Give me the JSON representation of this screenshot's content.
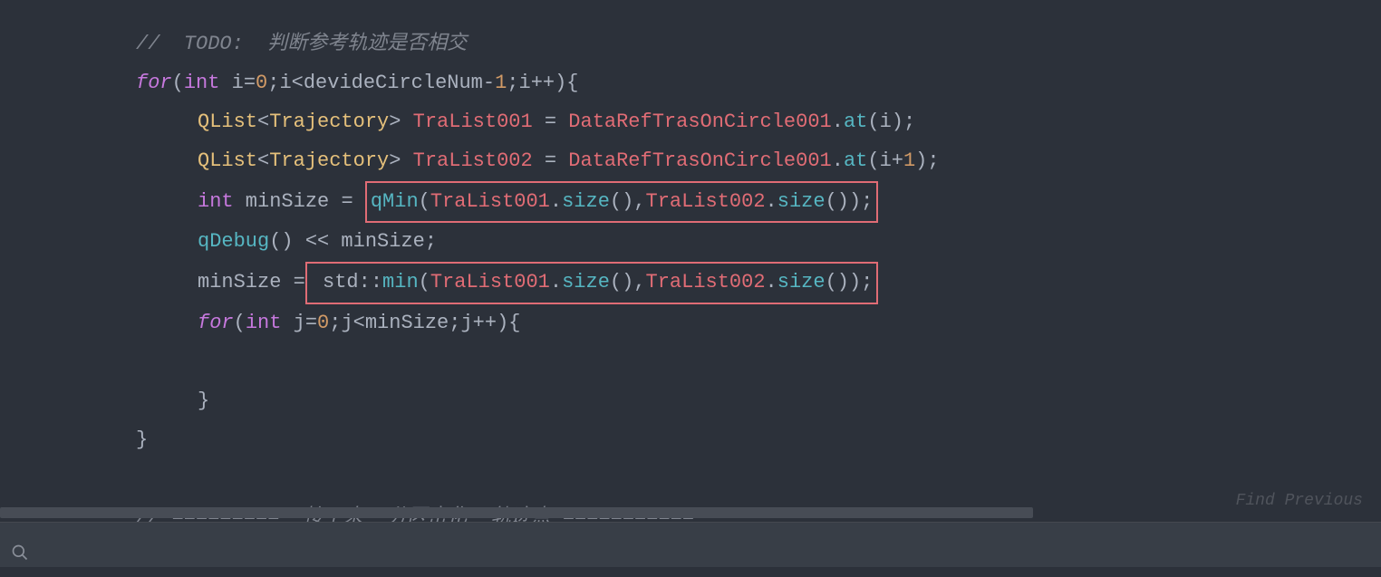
{
  "code": {
    "line1_comment": "//  TODO:  判断参考轨迹是否相交",
    "line2_for": "for",
    "line2_int": "int",
    "line2_var": "i",
    "line2_eq": "=",
    "line2_zero": "0",
    "line2_semi1": ";",
    "line2_var2": "i",
    "line2_lt": "<",
    "line2_devide": "devideCircleNum",
    "line2_minus": "-",
    "line2_one": "1",
    "line2_semi2": ";",
    "line2_var3": "i",
    "line2_inc": "++",
    "line2_paren": "){",
    "line3_qlist": "QList",
    "line3_lt": "<",
    "line3_traj": "Trajectory",
    "line3_gt": "> ",
    "line3_tralist": "TraList001",
    "line3_eq": " = ",
    "line3_dataref": "DataRefTrasOnCircle001",
    "line3_dot": ".",
    "line3_at": "at",
    "line3_paren1": "(",
    "line3_i": "i",
    "line3_paren2": ");",
    "line4_qlist": "QList",
    "line4_lt": "<",
    "line4_traj": "Trajectory",
    "line4_gt": "> ",
    "line4_tralist": "TraList002",
    "line4_eq": " = ",
    "line4_dataref": "DataRefTrasOnCircle001",
    "line4_dot": ".",
    "line4_at": "at",
    "line4_paren1": "(",
    "line4_i": "i",
    "line4_plus": "+",
    "line4_one": "1",
    "line4_paren2": ");",
    "line5_int": "int",
    "line5_minsize": " minSize ",
    "line5_eq": "= ",
    "line5_qmin": "qMin",
    "line5_paren1": "(",
    "line5_tra1": "TraList001",
    "line5_dot1": ".",
    "line5_size1": "size",
    "line5_par1": "()",
    "line5_comma": ",",
    "line5_tra2": "TraList002",
    "line5_dot2": ".",
    "line5_size2": "size",
    "line5_par2": "());",
    "line6_qdebug": "qDebug",
    "line6_paren": "() ",
    "line6_lshift": "<<",
    "line6_minsize": " minSize;",
    "line7_minsize": "minSize ",
    "line7_eq": "=",
    "line7_std": " std",
    "line7_colon": "::",
    "line7_min": "min",
    "line7_paren1": "(",
    "line7_tra1": "TraList001",
    "line7_dot1": ".",
    "line7_size1": "size",
    "line7_par1": "()",
    "line7_comma": ",",
    "line7_tra2": "TraList002",
    "line7_dot2": ".",
    "line7_size2": "size",
    "line7_par2": "());",
    "line8_for": "for",
    "line8_int": "int",
    "line8_j": " j",
    "line8_eq": "=",
    "line8_zero": "0",
    "line8_semi1": ";",
    "line8_j2": "j",
    "line8_lt": "<",
    "line8_minsize": "minSize",
    "line8_semi2": ";",
    "line8_j3": "j",
    "line8_inc": "++",
    "line8_paren": "){",
    "line9_empty": "",
    "line10_brace": "}",
    "line11_brace": "}",
    "line12_empty": "",
    "line13_comment": "// =========  接下来  分区密化  轨迹点 ==========="
  },
  "footer": {
    "find_label": "Find Previous"
  }
}
